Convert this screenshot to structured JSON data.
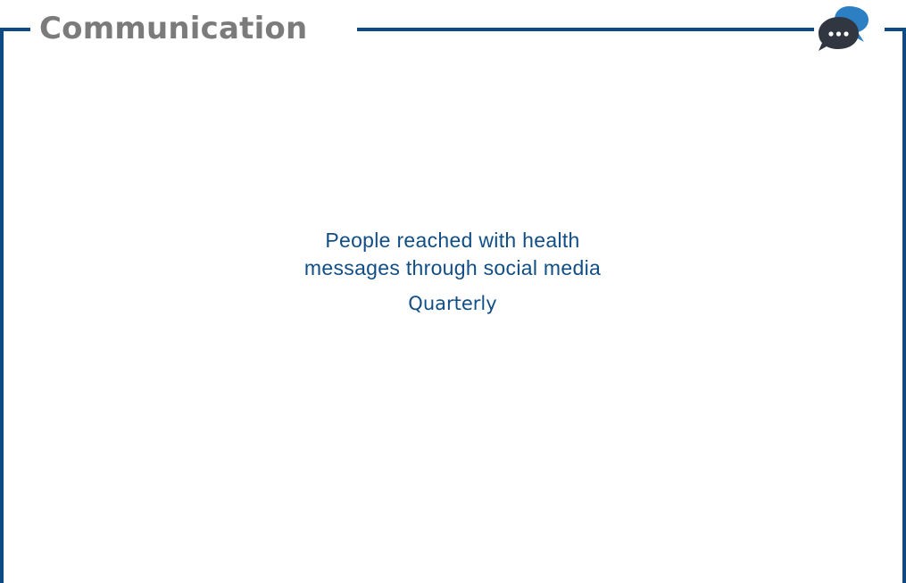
{
  "header": {
    "title": "Communication",
    "icon": "chat-bubbles-icon"
  },
  "indicator": {
    "title": "People reached with health messages through social media",
    "frequency": "Quarterly"
  },
  "colors": {
    "frame": "#0e4a86",
    "title": "#7b7b7b",
    "text": "#114e86",
    "icon_back": "#2b7fc2",
    "icon_front": "#313741"
  }
}
